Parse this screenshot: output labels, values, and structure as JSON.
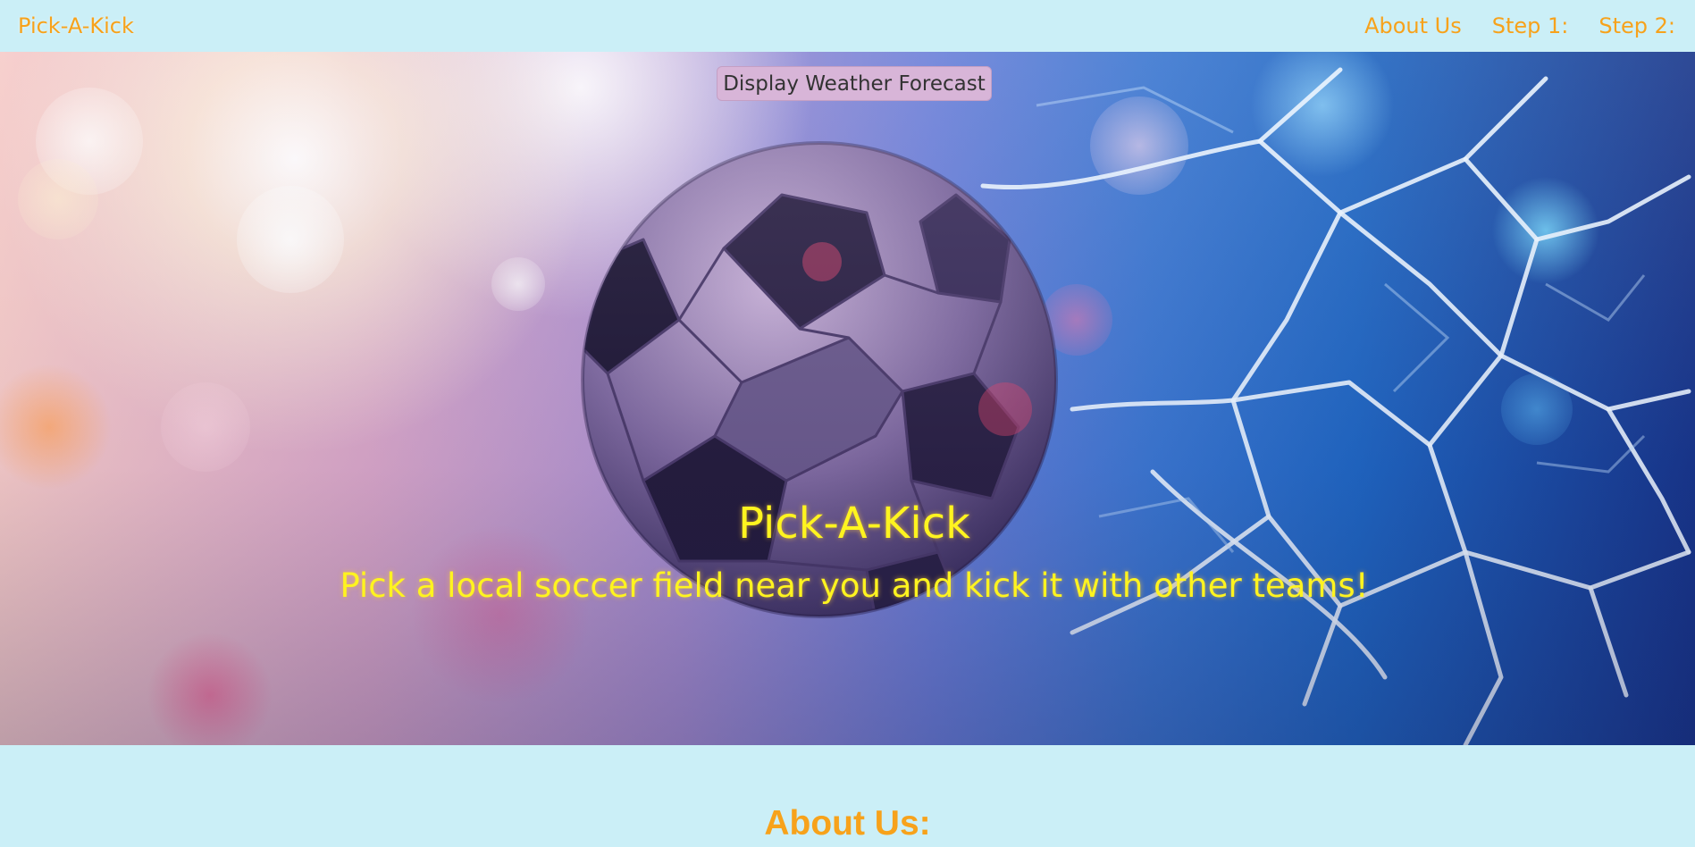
{
  "navbar": {
    "brand": "Pick-A-Kick",
    "links": [
      "About Us",
      "Step 1:",
      "Step 2:"
    ]
  },
  "hero": {
    "weather_button": "Display Weather Forecast",
    "title": "Pick-A-Kick",
    "subtitle": "Pick a local soccer field near you and kick it with other teams!",
    "image_alt": "soccer ball flying into a goal net"
  },
  "about": {
    "heading": "About Us:"
  },
  "colors": {
    "background": "#cbeff7",
    "nav_text": "#f7a21b",
    "hero_text": "#fff41f",
    "button_bg": "#d8b5d8"
  },
  "icons": {
    "ball": "soccer-ball-icon",
    "net": "goal-net-icon"
  }
}
